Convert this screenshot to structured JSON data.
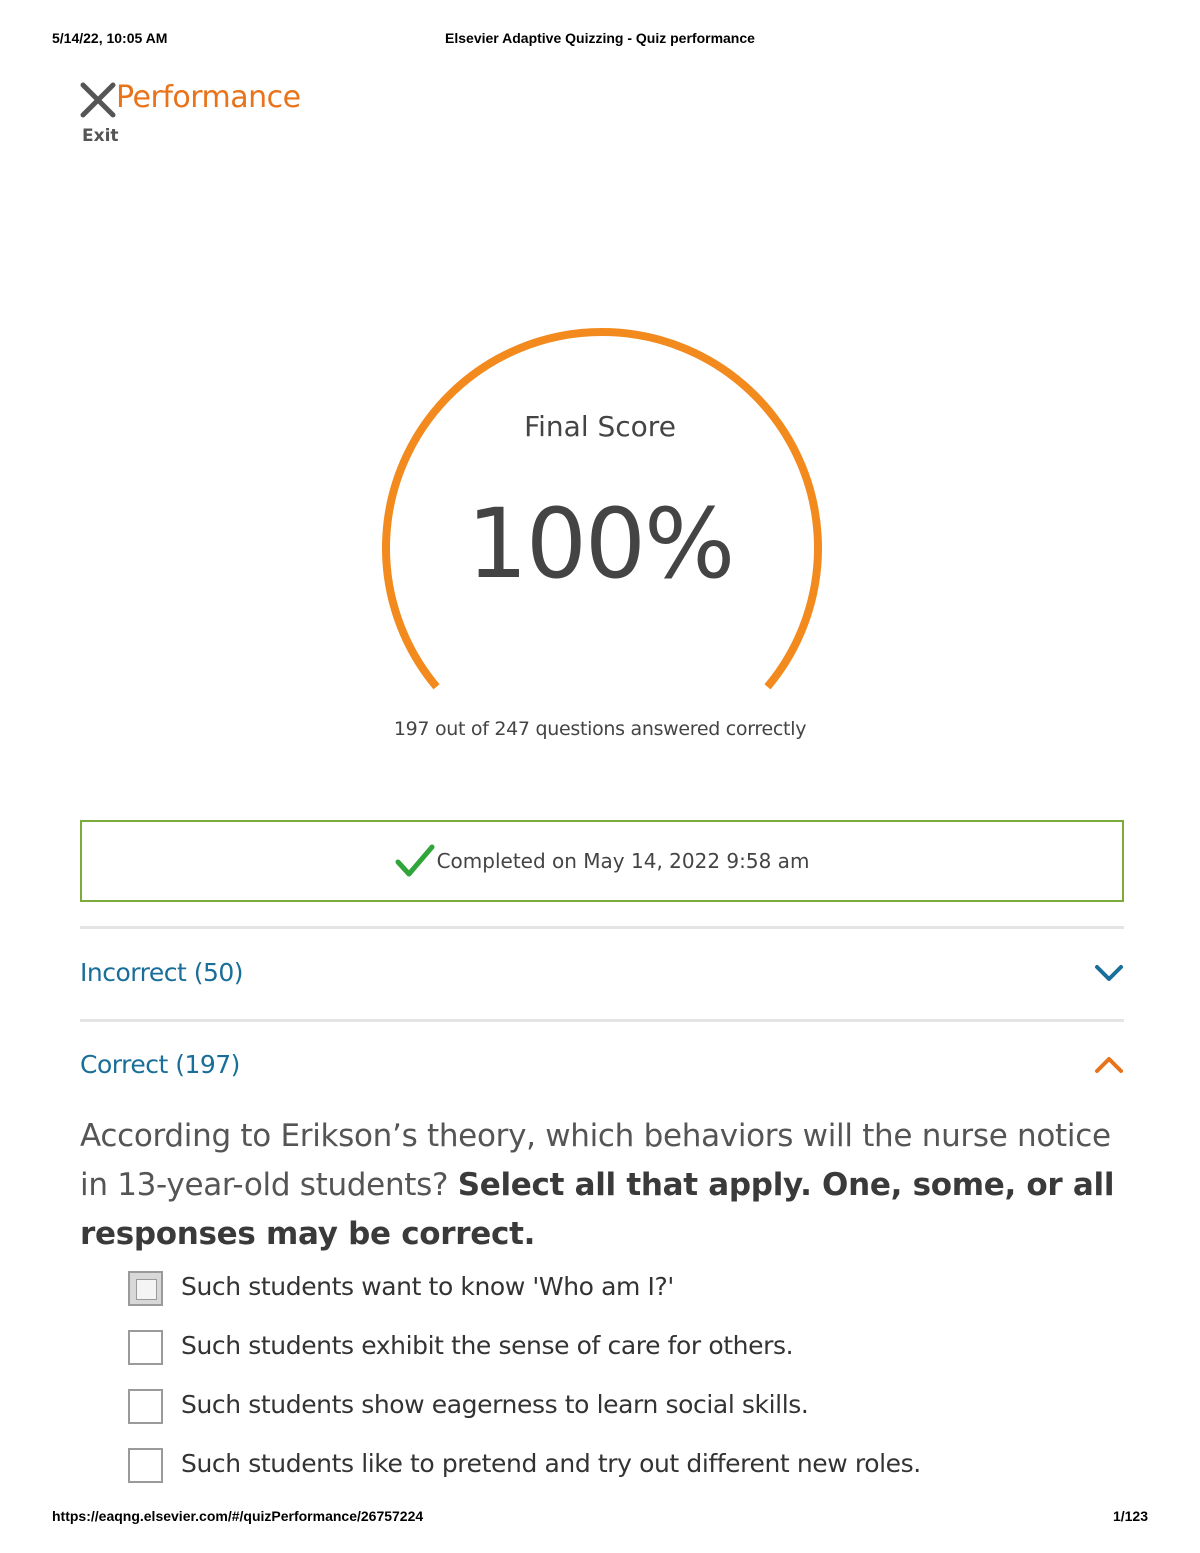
{
  "print_header": {
    "date": "5/14/22, 10:05 AM",
    "title": "Elsevier Adaptive Quizzing - Quiz performance"
  },
  "header": {
    "exit_icon": "close-icon",
    "title": "Performance",
    "exit_label": "Exit"
  },
  "score": {
    "label": "Final Score",
    "value": "100%",
    "summary": "197 out of 247 questions answered correctly",
    "ring_progress": 1.0
  },
  "completed": {
    "icon": "checkmark-icon",
    "text": "Completed on May 14, 2022 9:58 am"
  },
  "sections": {
    "incorrect": {
      "label": "Incorrect (50)",
      "icon": "chevron-down-icon"
    },
    "correct": {
      "label": "Correct (197)",
      "icon": "chevron-up-icon"
    }
  },
  "question": {
    "stem": "According to Erikson’s theory, which behaviors will the nurse notice in 13-year-old students? ",
    "instruction": "Select all that apply. One, some, or all responses may be correct.",
    "options": [
      {
        "label": "Such students want to know 'Who am I?'",
        "checked": true
      },
      {
        "label": "Such students exhibit the sense of care for others.",
        "checked": false
      },
      {
        "label": "Such students show eagerness to learn social skills.",
        "checked": false
      },
      {
        "label": "Such students like to pretend and try out different new roles.",
        "checked": false
      }
    ]
  },
  "print_footer": {
    "url": "https://eaqng.elsevier.com/#/quizPerformance/26757224",
    "page": "1/123"
  },
  "colors": {
    "accent_orange": "#f28a1e",
    "title_orange": "#e8731a",
    "link_blue": "#1a6e9a",
    "success_green": "#7cab3c",
    "check_green": "#2fa53a"
  }
}
